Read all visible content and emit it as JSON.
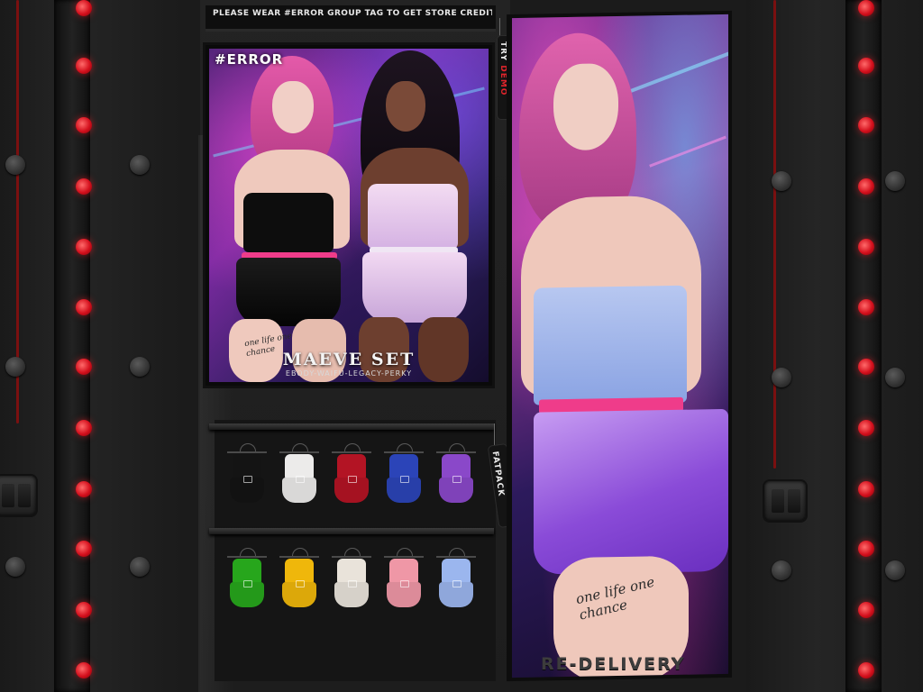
{
  "store": {
    "header_notice": "PLEASE WEAR #ERROR GROUP TAG TO GET STORE CREDIT!",
    "footer_label": "RE-DELIVERY"
  },
  "main_poster": {
    "brand": "#ERROR",
    "title": "MAEVE SET",
    "subtitle": "EBODY-WAIFU-LEGACY-PERKY",
    "tattoo_text": "one life one chance"
  },
  "side_poster": {
    "tattoo_text": "one life one chance"
  },
  "tags": {
    "try_demo": {
      "prefix": "TRY ",
      "accent": "DEMO"
    },
    "fatpack": "FATPACK"
  },
  "outfits": {
    "row1": [
      {
        "name": "black",
        "color": "#141414"
      },
      {
        "name": "white",
        "color": "#ecebea"
      },
      {
        "name": "red",
        "color": "#b31424"
      },
      {
        "name": "blue",
        "color": "#2b44b8"
      },
      {
        "name": "purple",
        "color": "#8a48c9"
      }
    ],
    "row2": [
      {
        "name": "green",
        "color": "#27a61c"
      },
      {
        "name": "yellow",
        "color": "#efb70b"
      },
      {
        "name": "cream",
        "color": "#e9e3da"
      },
      {
        "name": "pink",
        "color": "#ef97a6"
      },
      {
        "name": "light-blue",
        "color": "#9bb6ee"
      }
    ]
  },
  "colors": {
    "led": "#d4101d",
    "accent_pink": "#ef3c8a"
  }
}
